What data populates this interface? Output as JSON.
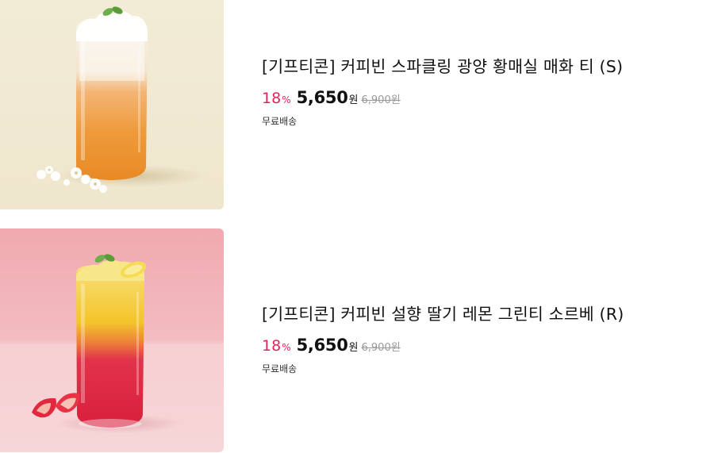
{
  "products": [
    {
      "title": "[기프티콘] 커피빈 스파클링 광양 황매실 매화 티 (S)",
      "discount": "18",
      "discount_unit": "%",
      "price": "5,650",
      "currency": "원",
      "original_price": "6,900원",
      "shipping": "무료배송",
      "image": "sparkling-maesil-tea-image",
      "bg_color": "#f1ead4"
    },
    {
      "title": "[기프티콘] 커피빈 설향 딸기 레몬 그린티 소르베 (R)",
      "discount": "18",
      "discount_unit": "%",
      "price": "5,650",
      "currency": "원",
      "original_price": "6,900원",
      "shipping": "무료배송",
      "image": "strawberry-lemon-sorbet-image",
      "bg_color": "#f2b9bd"
    }
  ],
  "colors": {
    "discount": "#e0275b",
    "text": "#111111",
    "muted": "#999999"
  }
}
